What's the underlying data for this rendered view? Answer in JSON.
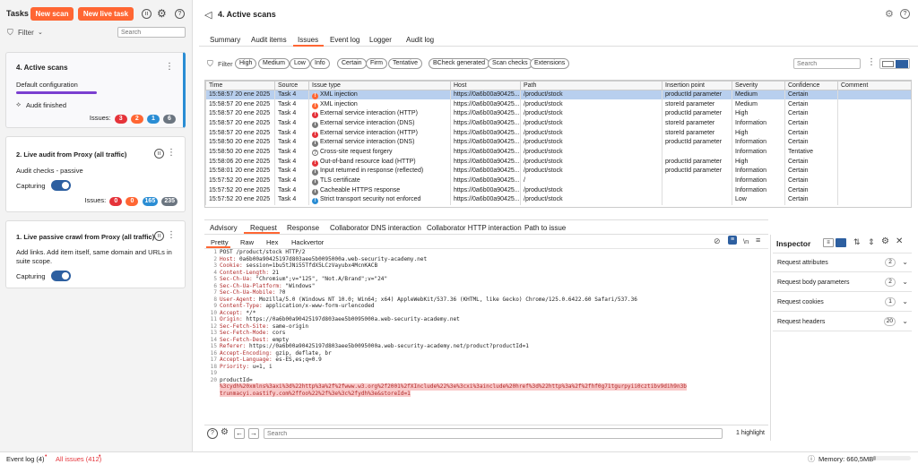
{
  "left": {
    "title": "Tasks",
    "new_scan": "New scan",
    "new_live_task": "New live task",
    "filter_label": "Filter",
    "search_placeholder": "Search",
    "tasks": [
      {
        "title": "4. Active scans",
        "subtitle": "Default configuration",
        "status": "Audit finished",
        "issues_label": "Issues:",
        "counts": [
          "3",
          "2",
          "1",
          "6"
        ]
      },
      {
        "title": "2. Live audit from Proxy (all traffic)",
        "subtitle": "Audit checks - passive",
        "capture_label": "Capturing",
        "issues_label": "Issues:",
        "counts": [
          "0",
          "0",
          "165",
          "235"
        ]
      },
      {
        "title": "1. Live passive crawl from Proxy (all traffic)",
        "subtitle": "Add links. Add item itself, same domain and URLs in suite scope.",
        "capture_label": "Capturing"
      }
    ]
  },
  "header": {
    "title": "4. Active scans"
  },
  "tabs": [
    "Summary",
    "Audit items",
    "Issues",
    "Event log",
    "Logger",
    "Audit log"
  ],
  "filter_bar": {
    "filter_label": "Filter",
    "severity": [
      "High",
      "Medium",
      "Low",
      "Info"
    ],
    "confidence": [
      "Certain",
      "Firm",
      "Tentative"
    ],
    "source": [
      "BCheck generated",
      "Scan checks",
      "Extensions"
    ],
    "search_placeholder": "Search"
  },
  "table": {
    "columns": [
      "Time",
      "Source",
      "Issue type",
      "Host",
      "Path",
      "Insertion point",
      "Severity",
      "Confidence",
      "Comment"
    ],
    "rows": [
      {
        "time": "15:58:57 20 ene 2025",
        "source": "Task 4",
        "sev": "medium",
        "issue": "XML injection",
        "host": "https://0a6b00a90425...",
        "path": "/product/stock",
        "ip": "productId parameter",
        "severity": "Medium",
        "confidence": "Certain"
      },
      {
        "time": "15:58:57 20 ene 2025",
        "source": "Task 4",
        "sev": "medium",
        "issue": "XML injection",
        "host": "https://0a6b00a90425...",
        "path": "/product/stock",
        "ip": "storeId parameter",
        "severity": "Medium",
        "confidence": "Certain"
      },
      {
        "time": "15:58:57 20 ene 2025",
        "source": "Task 4",
        "sev": "high",
        "issue": "External service interaction (HTTP)",
        "host": "https://0a6b00a90425...",
        "path": "/product/stock",
        "ip": "productId parameter",
        "severity": "High",
        "confidence": "Certain"
      },
      {
        "time": "15:58:57 20 ene 2025",
        "source": "Task 4",
        "sev": "info",
        "issue": "External service interaction (DNS)",
        "host": "https://0a6b00a90425...",
        "path": "/product/stock",
        "ip": "storeId parameter",
        "severity": "Information",
        "confidence": "Certain"
      },
      {
        "time": "15:58:57 20 ene 2025",
        "source": "Task 4",
        "sev": "high",
        "issue": "External service interaction (HTTP)",
        "host": "https://0a6b00a90425...",
        "path": "/product/stock",
        "ip": "storeId parameter",
        "severity": "High",
        "confidence": "Certain"
      },
      {
        "time": "15:58:50 20 ene 2025",
        "source": "Task 4",
        "sev": "info",
        "issue": "External service interaction (DNS)",
        "host": "https://0a6b00a90425...",
        "path": "/product/stock",
        "ip": "productId parameter",
        "severity": "Information",
        "confidence": "Certain"
      },
      {
        "time": "15:58:50 20 ene 2025",
        "source": "Task 4",
        "sev": "tent",
        "issue": "Cross-site request forgery",
        "host": "https://0a6b00a90425...",
        "path": "/product/stock",
        "ip": "",
        "severity": "Information",
        "confidence": "Tentative"
      },
      {
        "time": "15:58:06 20 ene 2025",
        "source": "Task 4",
        "sev": "high",
        "issue": "Out-of-band resource load (HTTP)",
        "host": "https://0a6b00a90425...",
        "path": "/product/stock",
        "ip": "productId parameter",
        "severity": "High",
        "confidence": "Certain"
      },
      {
        "time": "15:58:01 20 ene 2025",
        "source": "Task 4",
        "sev": "info",
        "issue": "Input returned in response (reflected)",
        "host": "https://0a6b00a90425...",
        "path": "/product/stock",
        "ip": "productId parameter",
        "severity": "Information",
        "confidence": "Certain"
      },
      {
        "time": "15:57:52 20 ene 2025",
        "source": "Task 4",
        "sev": "info",
        "issue": "TLS certificate",
        "host": "https://0a6b00a90425...",
        "path": "/",
        "ip": "",
        "severity": "Information",
        "confidence": "Certain"
      },
      {
        "time": "15:57:52 20 ene 2025",
        "source": "Task 4",
        "sev": "info",
        "issue": "Cacheable HTTPS response",
        "host": "https://0a6b00a90425...",
        "path": "/product/stock",
        "ip": "",
        "severity": "Information",
        "confidence": "Certain"
      },
      {
        "time": "15:57:52 20 ene 2025",
        "source": "Task 4",
        "sev": "low",
        "issue": "Strict transport security not enforced",
        "host": "https://0a6b00a90425...",
        "path": "/product/stock",
        "ip": "",
        "severity": "Low",
        "confidence": "Certain"
      }
    ]
  },
  "detail_tabs": [
    "Advisory",
    "Request",
    "Response",
    "Collaborator DNS interaction",
    "Collaborator HTTP interaction",
    "Path to issue"
  ],
  "editor_tabs": [
    "Pretty",
    "Raw",
    "Hex",
    "Hackvertor"
  ],
  "request_lines": [
    [
      "1",
      "POST /product/stock HTTP/2",
      ""
    ],
    [
      "2",
      "Host: ",
      "0a6b00a90425197d803aee5b0095000a.web-security-academy.net"
    ],
    [
      "3",
      "Cookie: ",
      "session=1bu5tJNi55TfdX5LCzVayubx4McnKACB"
    ],
    [
      "4",
      "Content-Length: ",
      "21"
    ],
    [
      "5",
      "Sec-Ch-Ua: ",
      "\"Chromium\";v=\"125\", \"Not.A/Brand\";v=\"24\""
    ],
    [
      "6",
      "Sec-Ch-Ua-Platform: ",
      "\"Windows\""
    ],
    [
      "7",
      "Sec-Ch-Ua-Mobile: ",
      "?0"
    ],
    [
      "8",
      "User-Agent: ",
      "Mozilla/5.0 (Windows NT 10.0; Win64; x64) AppleWebKit/537.36 (KHTML, like Gecko) Chrome/125.0.6422.60 Safari/537.36"
    ],
    [
      "9",
      "Content-Type: ",
      "application/x-www-form-urlencoded"
    ],
    [
      "10",
      "Accept: ",
      "*/*"
    ],
    [
      "11",
      "Origin: ",
      "https://0a6b00a90425197d803aee5b0095000a.web-security-academy.net"
    ],
    [
      "12",
      "Sec-Fetch-Site: ",
      "same-origin"
    ],
    [
      "13",
      "Sec-Fetch-Mode: ",
      "cors"
    ],
    [
      "14",
      "Sec-Fetch-Dest: ",
      "empty"
    ],
    [
      "15",
      "Referer: ",
      "https://0a6b00a90425197d803aee5b0095000a.web-security-academy.net/product?productId=1"
    ],
    [
      "16",
      "Accept-Encoding: ",
      "gzip, deflate, br"
    ],
    [
      "17",
      "Accept-Language: ",
      "es-ES,es;q=0.9"
    ],
    [
      "18",
      "Priority: ",
      "u=1, i"
    ],
    [
      "19",
      "",
      ""
    ],
    [
      "20",
      "productId=",
      ""
    ]
  ],
  "request_body": [
    "%3cydh%20xmlns%3axi%3d%22http%3a%2f%2fwww.w3.org%2f2001%2fXInclude%22%3e%3cxi%3ainclude%20href%3d%22http%3a%2f%2fhf0g71tgurpyii0cztibv9dih9n3b",
    "trunmacyi.oastify.com%2ffoo%22%2f%3e%3c%2fydh%3e&storeId=1"
  ],
  "editor_footer": {
    "search_placeholder": "Search",
    "highlight": "1 highlight"
  },
  "inspector": {
    "title": "Inspector",
    "rows": [
      {
        "label": "Request attributes",
        "count": "2"
      },
      {
        "label": "Request body parameters",
        "count": "2"
      },
      {
        "label": "Request cookies",
        "count": "1"
      },
      {
        "label": "Request headers",
        "count": "20"
      }
    ]
  },
  "status_bar": {
    "event_log": "Event log (4)",
    "all_issues": "All issues (412)",
    "memory": "Memory: 660,5MB"
  }
}
